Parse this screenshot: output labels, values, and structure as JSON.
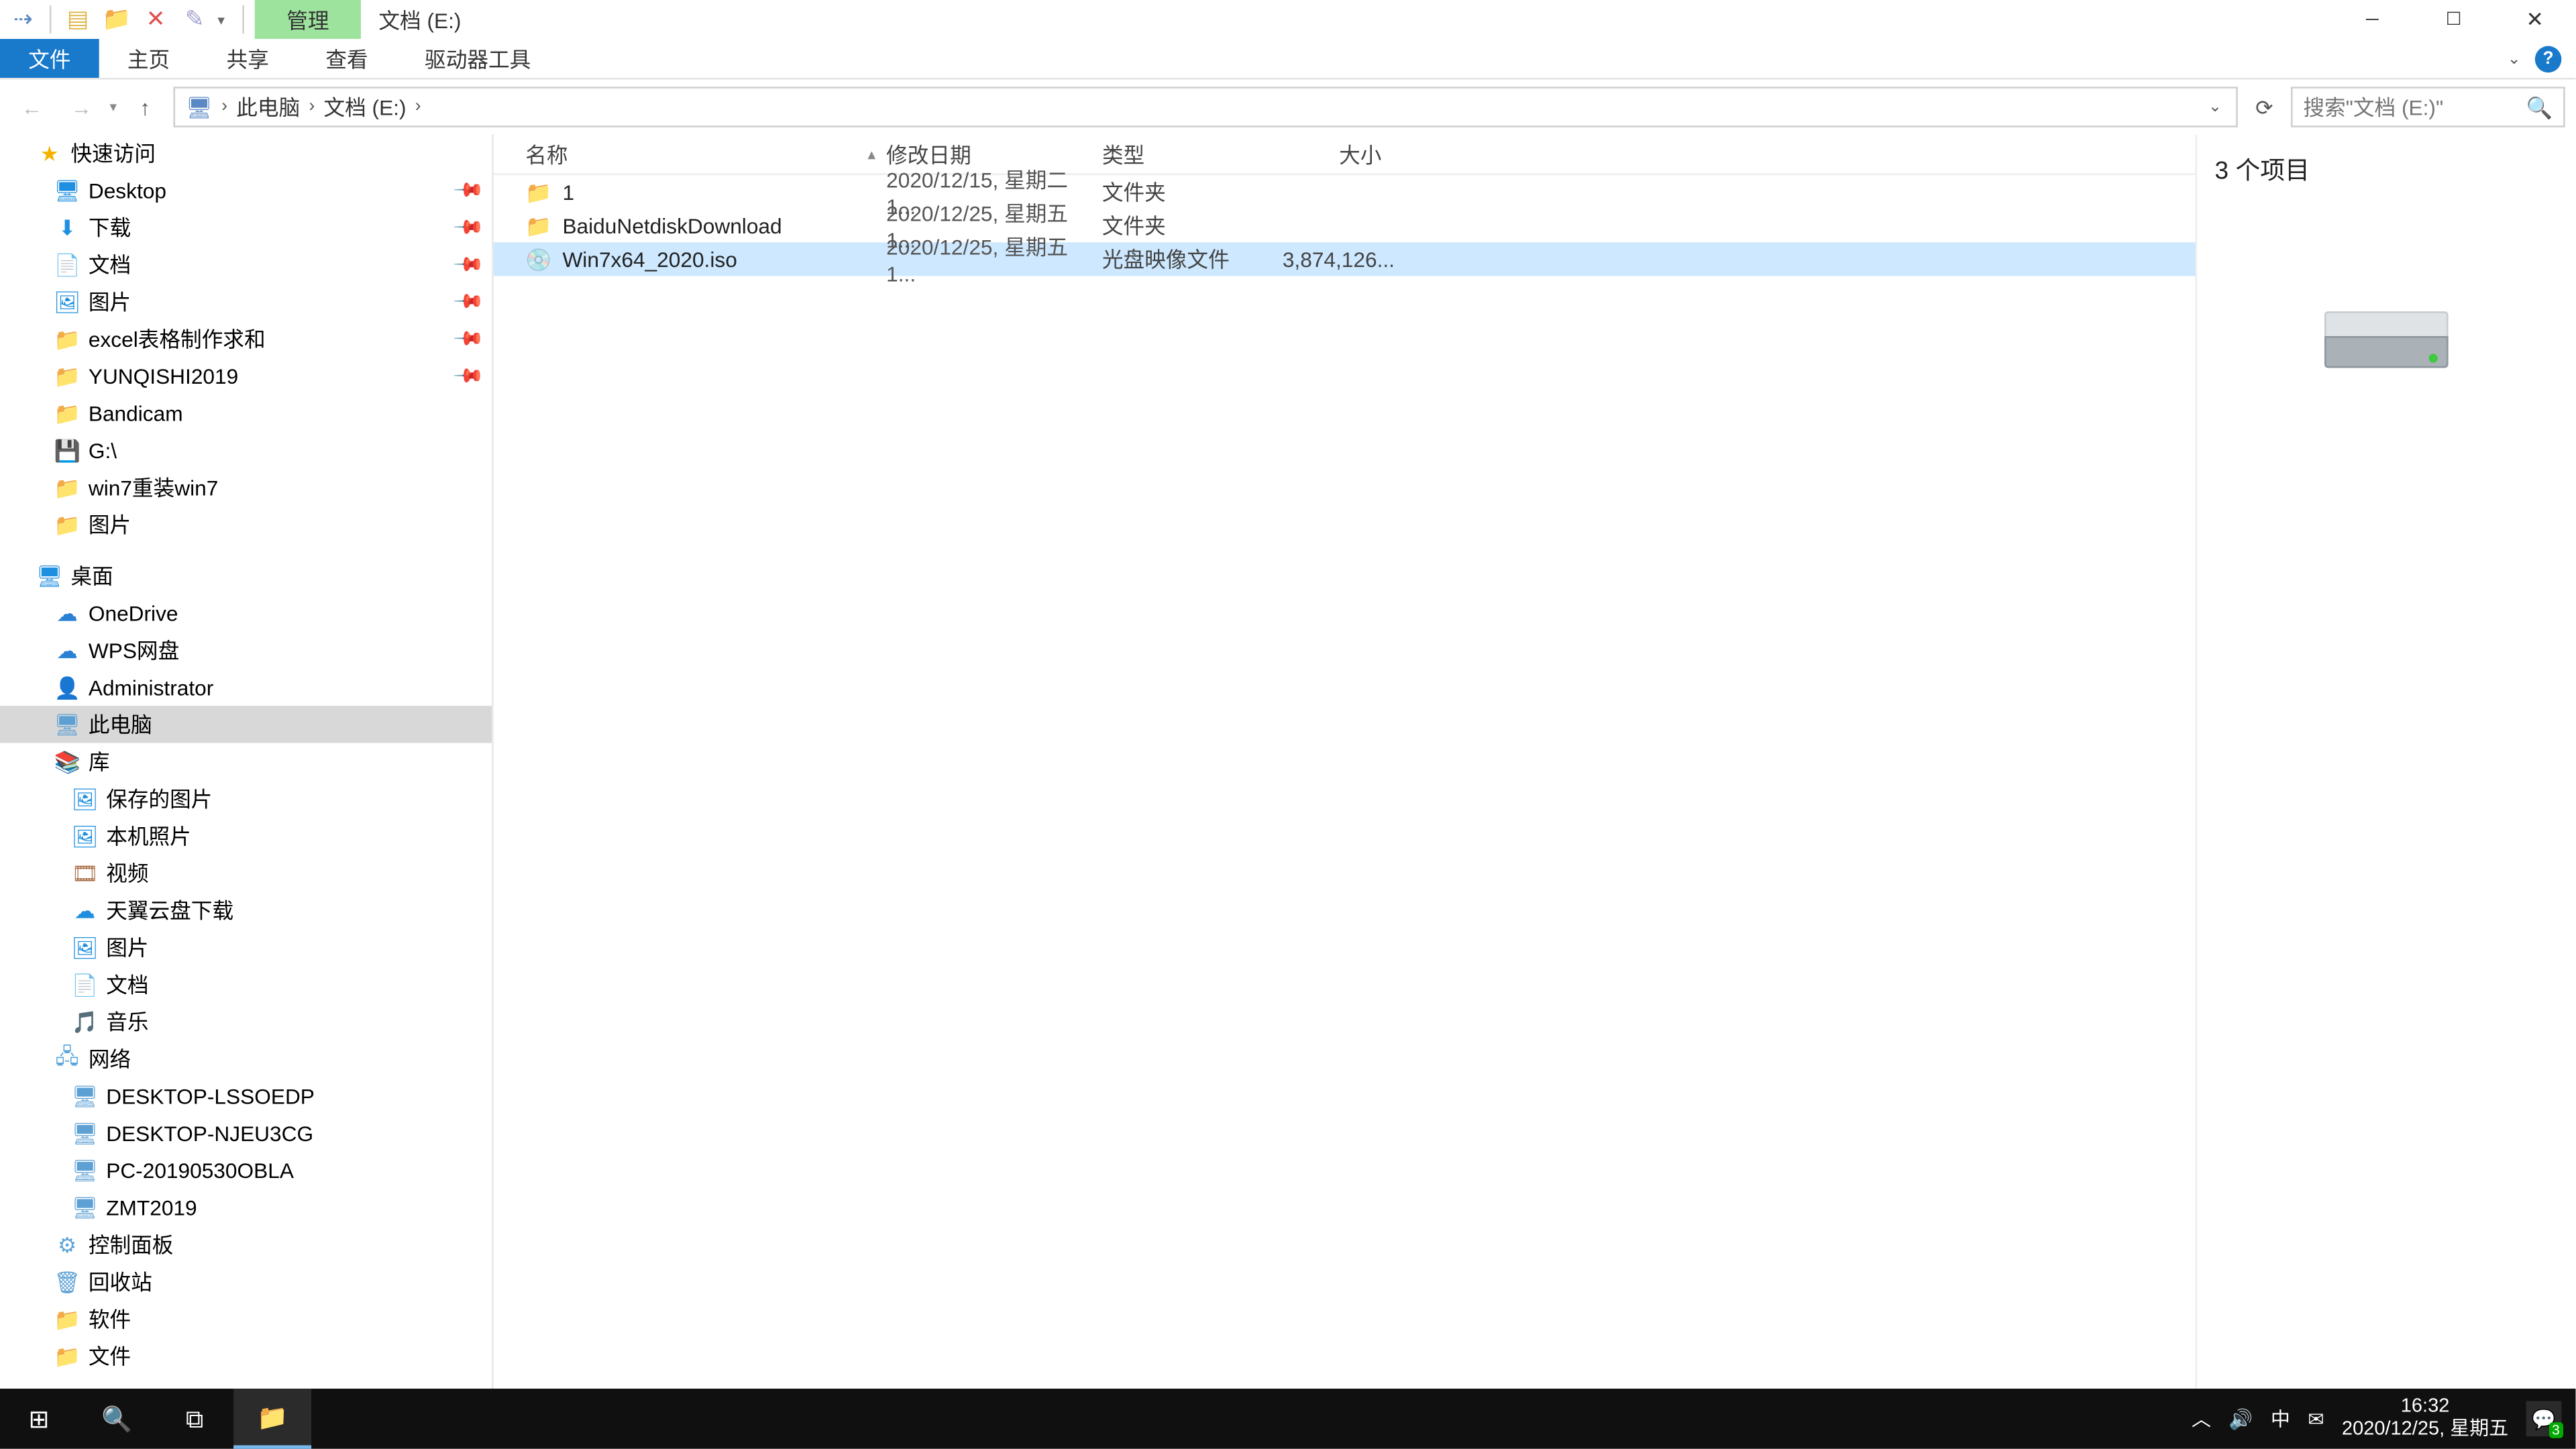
{
  "title": "文档 (E:)",
  "ribbon": {
    "context_tab": "管理",
    "file": "文件",
    "tabs": [
      "主页",
      "共享",
      "查看",
      "驱动器工具"
    ]
  },
  "address": {
    "root_icon": "pc",
    "parts": [
      "此电脑",
      "文档 (E:)"
    ]
  },
  "search_placeholder": "搜索\"文档 (E:)\"",
  "columns": {
    "name": "名称",
    "date": "修改日期",
    "type": "类型",
    "size": "大小"
  },
  "files": [
    {
      "name": "1",
      "date": "2020/12/15, 星期二 1...",
      "type": "文件夹",
      "size": "",
      "icon": "folder",
      "selected": false
    },
    {
      "name": "BaiduNetdiskDownload",
      "date": "2020/12/25, 星期五 1...",
      "type": "文件夹",
      "size": "",
      "icon": "folder",
      "selected": false
    },
    {
      "name": "Win7x64_2020.iso",
      "date": "2020/12/25, 星期五 1...",
      "type": "光盘映像文件",
      "size": "3,874,126...",
      "icon": "iso",
      "selected": true
    }
  ],
  "tree": [
    {
      "label": "快速访问",
      "depth": "d0",
      "icon": "star",
      "glyph": "★",
      "pin": false
    },
    {
      "label": "Desktop",
      "depth": "d1",
      "icon": "blue",
      "glyph": "🖥",
      "pin": true
    },
    {
      "label": "下载",
      "depth": "d1",
      "icon": "blue",
      "glyph": "⬇",
      "pin": true
    },
    {
      "label": "文档",
      "depth": "d1",
      "icon": "folder",
      "glyph": "📄",
      "pin": true
    },
    {
      "label": "图片",
      "depth": "d1",
      "icon": "blue",
      "glyph": "🖼",
      "pin": true
    },
    {
      "label": "excel表格制作求和",
      "depth": "d1",
      "icon": "folder",
      "glyph": "📁",
      "pin": true
    },
    {
      "label": "YUNQISHI2019",
      "depth": "d1",
      "icon": "folder",
      "glyph": "📁",
      "pin": true
    },
    {
      "label": "Bandicam",
      "depth": "d1",
      "icon": "folder",
      "glyph": "📁",
      "pin": false
    },
    {
      "label": "G:\\",
      "depth": "d1",
      "icon": "disk",
      "glyph": "💾",
      "pin": false
    },
    {
      "label": "win7重装win7",
      "depth": "d1",
      "icon": "folder",
      "glyph": "📁",
      "pin": false
    },
    {
      "label": "图片",
      "depth": "d1",
      "icon": "folder",
      "glyph": "📁",
      "pin": false
    },
    {
      "label": "桌面",
      "depth": "d0",
      "icon": "blue",
      "glyph": "🖥",
      "pin": false,
      "spaced": true
    },
    {
      "label": "OneDrive",
      "depth": "d1a",
      "icon": "onedrive",
      "glyph": "☁",
      "pin": false
    },
    {
      "label": "WPS网盘",
      "depth": "d1a",
      "icon": "wps",
      "glyph": "☁",
      "pin": false
    },
    {
      "label": "Administrator",
      "depth": "d1a",
      "icon": "user",
      "glyph": "👤",
      "pin": false
    },
    {
      "label": "此电脑",
      "depth": "d1a",
      "icon": "pc",
      "glyph": "🖥",
      "pin": false,
      "selected": true
    },
    {
      "label": "库",
      "depth": "d1a",
      "icon": "lib",
      "glyph": "📚",
      "pin": false
    },
    {
      "label": "保存的图片",
      "depth": "d2",
      "icon": "blue",
      "glyph": "🖼",
      "pin": false
    },
    {
      "label": "本机照片",
      "depth": "d2",
      "icon": "blue",
      "glyph": "🖼",
      "pin": false
    },
    {
      "label": "视频",
      "depth": "d2",
      "icon": "video",
      "glyph": "🎞",
      "pin": false
    },
    {
      "label": "天翼云盘下载",
      "depth": "d2",
      "icon": "blue",
      "glyph": "☁",
      "pin": false
    },
    {
      "label": "图片",
      "depth": "d2",
      "icon": "blue",
      "glyph": "🖼",
      "pin": false
    },
    {
      "label": "文档",
      "depth": "d2",
      "icon": "folder",
      "glyph": "📄",
      "pin": false
    },
    {
      "label": "音乐",
      "depth": "d2",
      "icon": "folder",
      "glyph": "🎵",
      "pin": false
    },
    {
      "label": "网络",
      "depth": "d1a",
      "icon": "network",
      "glyph": "🖧",
      "pin": false
    },
    {
      "label": "DESKTOP-LSSOEDP",
      "depth": "d2",
      "icon": "pc",
      "glyph": "🖥",
      "pin": false
    },
    {
      "label": "DESKTOP-NJEU3CG",
      "depth": "d2",
      "icon": "pc",
      "glyph": "🖥",
      "pin": false
    },
    {
      "label": "PC-20190530OBLA",
      "depth": "d2",
      "icon": "pc",
      "glyph": "🖥",
      "pin": false
    },
    {
      "label": "ZMT2019",
      "depth": "d2",
      "icon": "pc",
      "glyph": "🖥",
      "pin": false
    },
    {
      "label": "控制面板",
      "depth": "d1a",
      "icon": "panel",
      "glyph": "⚙",
      "pin": false
    },
    {
      "label": "回收站",
      "depth": "d1a",
      "icon": "recycle",
      "glyph": "🗑",
      "pin": false
    },
    {
      "label": "软件",
      "depth": "d1a",
      "icon": "folder",
      "glyph": "📁",
      "pin": false
    },
    {
      "label": "文件",
      "depth": "d1a",
      "icon": "folder",
      "glyph": "📁",
      "pin": false
    }
  ],
  "preview": {
    "header": "3 个项目"
  },
  "status": "3 个项目",
  "taskbar": {
    "time": "16:32",
    "date": "2020/12/25, 星期五",
    "ime": "中",
    "notif_count": "3"
  }
}
